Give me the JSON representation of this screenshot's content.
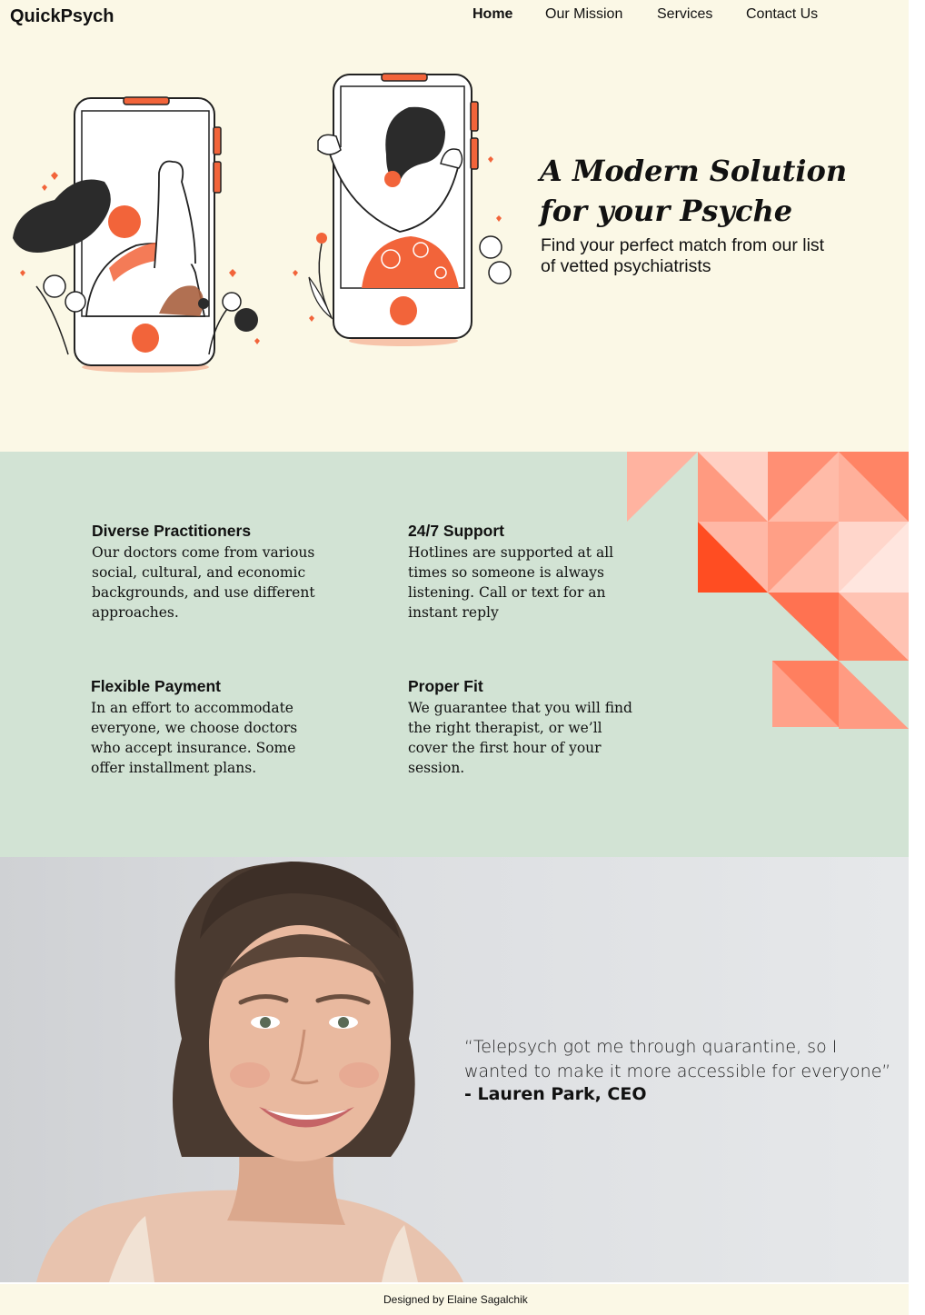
{
  "brand": {
    "name": "QuickPsych",
    "colors": {
      "cream": "#fbf8e6",
      "mint": "#d2e3d4",
      "accent": "#f2643a",
      "ink": "#222222"
    }
  },
  "nav": {
    "items": [
      {
        "label": "Home",
        "active": true
      },
      {
        "label": "Our Mission",
        "active": false
      },
      {
        "label": "Services",
        "active": false
      },
      {
        "label": "Contact Us",
        "active": false
      }
    ]
  },
  "hero": {
    "title_line1": "A Modern Solution",
    "title_line2": "for your Psyche",
    "subtitle": "Find your perfect match from our list of vetted psychiatrists",
    "illustration_icon": "phones-video-call-illustration"
  },
  "features": [
    {
      "title": "Diverse Practitioners",
      "body": "Our doctors come from various social, cultural, and economic backgrounds, and use different approaches."
    },
    {
      "title": "24/7 Support",
      "body": "Hotlines are supported at all times so someone is always listening. Call or text for an instant reply"
    },
    {
      "title": "Flexible Payment",
      "body": "In an effort to accommodate everyone, we choose doctors who accept insurance. Some offer installment plans."
    },
    {
      "title": "Proper Fit",
      "body": "We guarantee that you will find the right therapist, or we’ll cover the first hour of your session."
    }
  ],
  "testimonial": {
    "quote": "“Telepsych got me through quarantine, so I wanted to make it more accessible for everyone”",
    "author": "- Lauren Park, CEO",
    "photo_icon": "smiling-woman-portrait"
  },
  "footer": {
    "credit": "Designed by Elaine Sagalchik"
  }
}
